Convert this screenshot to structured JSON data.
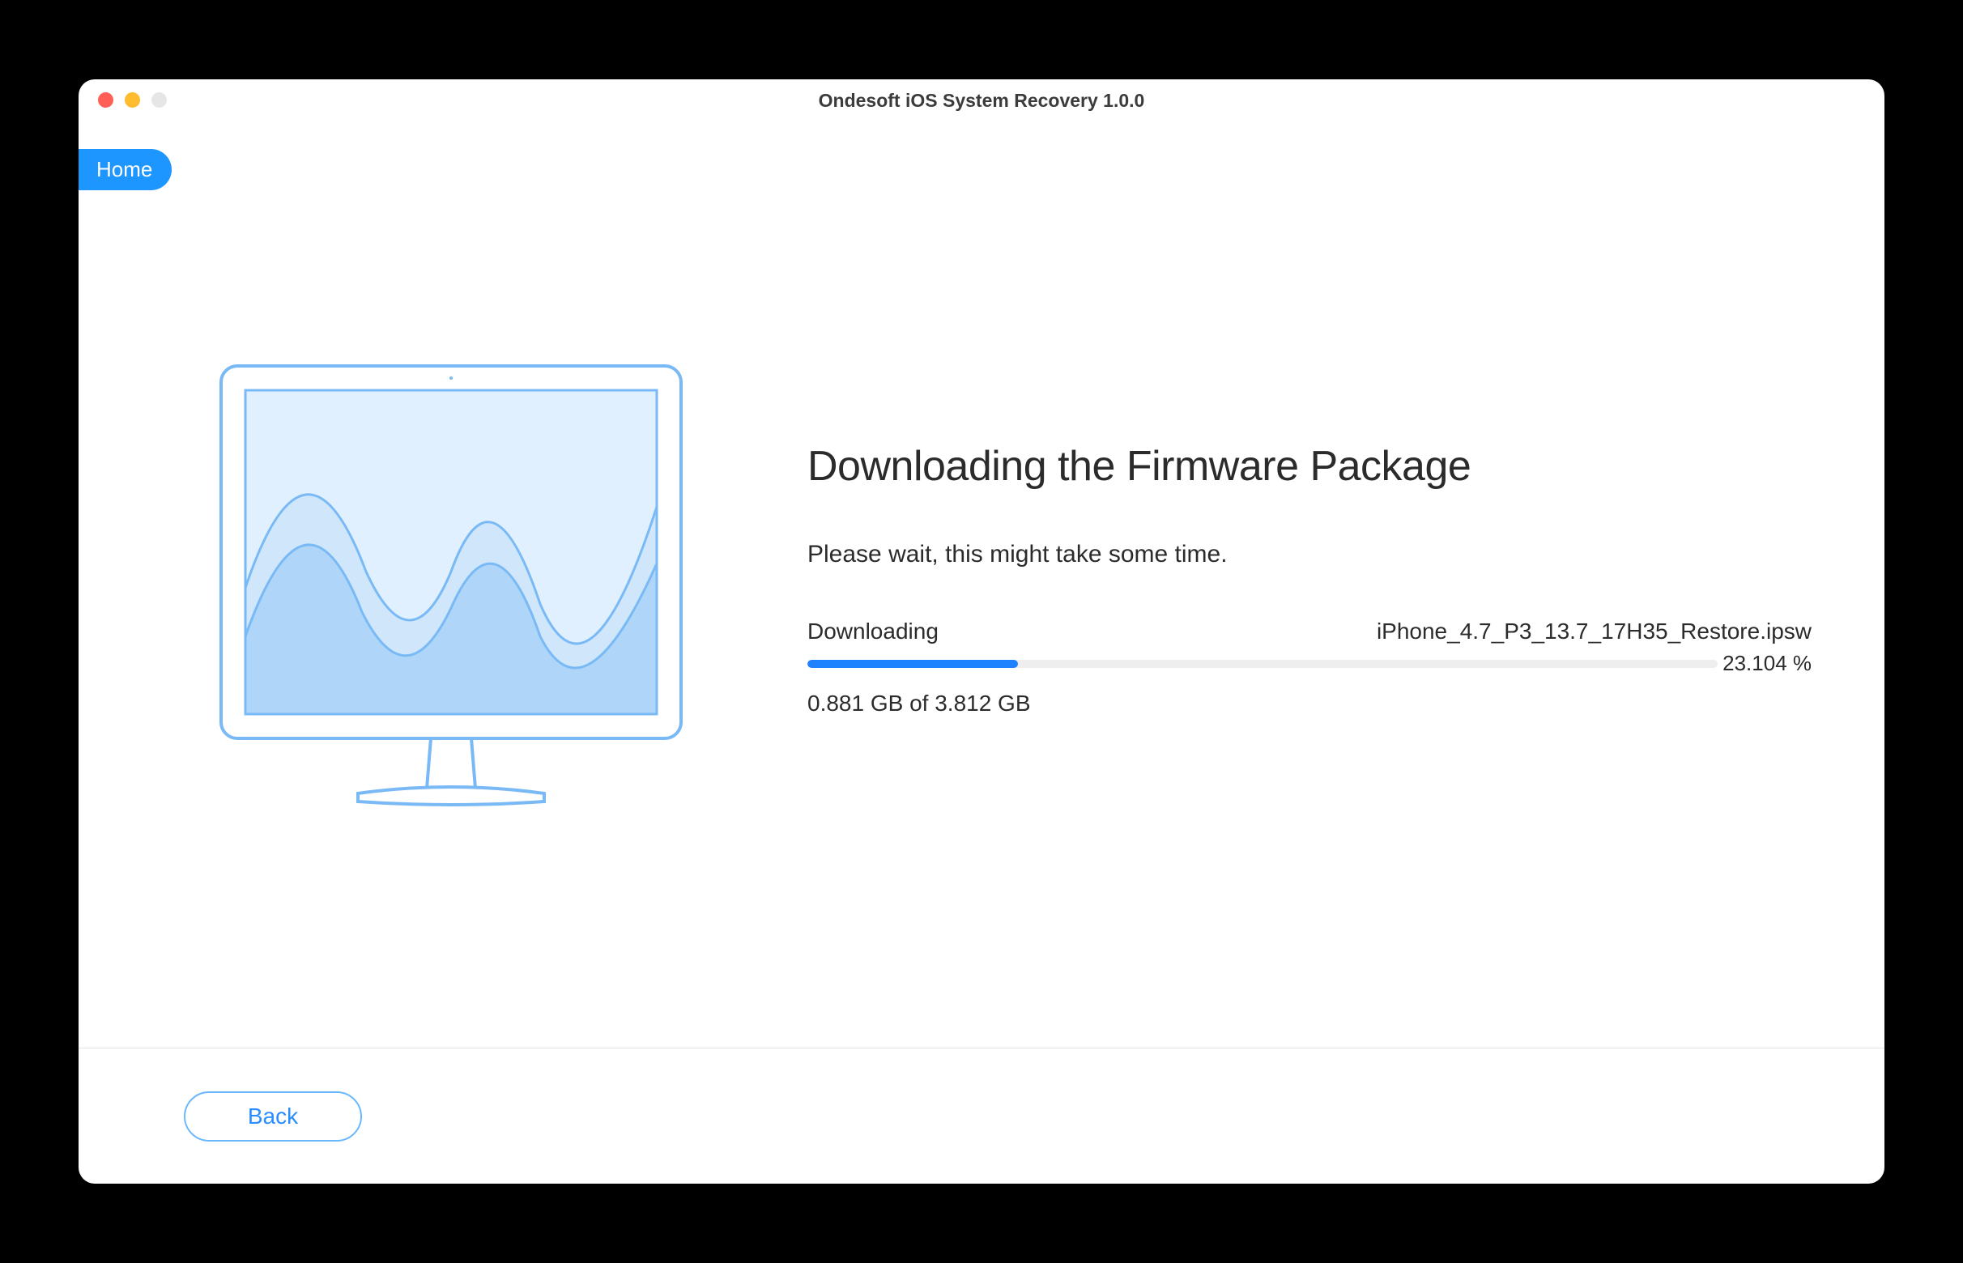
{
  "window": {
    "title": "Ondesoft iOS System Recovery 1.0.0"
  },
  "nav": {
    "home_label": "Home"
  },
  "main": {
    "headline": "Downloading the Firmware Package",
    "subhead": "Please wait, this might take some time.",
    "status_label": "Downloading",
    "filename": "iPhone_4.7_P3_13.7_17H35_Restore.ipsw",
    "progress_percent": 23.104,
    "progress_percent_label": "23.104 %",
    "size_label": "0.881 GB of 3.812 GB"
  },
  "footer": {
    "back_label": "Back"
  },
  "colors": {
    "accent": "#1e96ff",
    "progress": "#1e82ff"
  }
}
